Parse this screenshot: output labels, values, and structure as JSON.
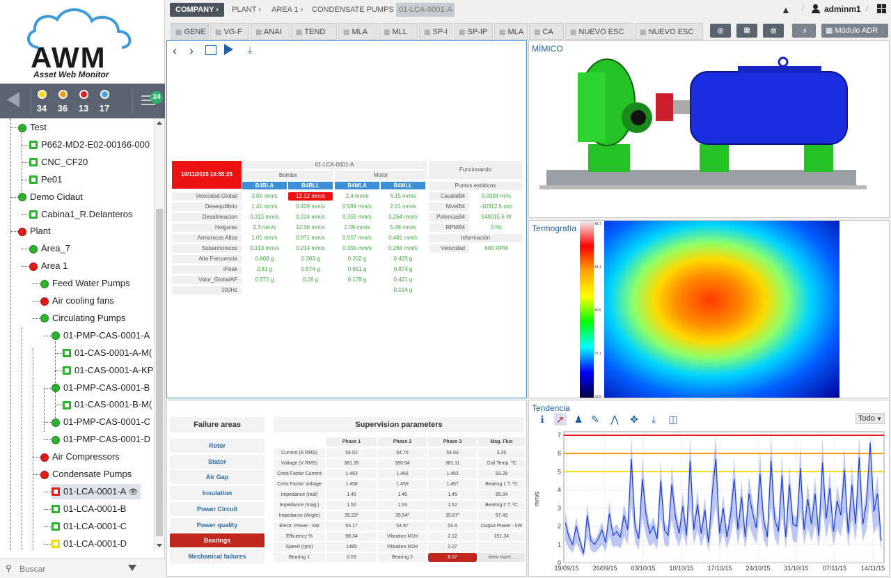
{
  "app": {
    "name": "AWM",
    "subtitle": "Asset Web Monitor"
  },
  "status": {
    "counts": [
      {
        "color": "#f5d90a",
        "value": "34"
      },
      {
        "color": "#f39c12",
        "value": "36"
      },
      {
        "color": "#e31b1b",
        "value": "13"
      },
      {
        "color": "#4ea3dc",
        "value": "17"
      }
    ],
    "list_badge": "24"
  },
  "tree": [
    {
      "label": "Test",
      "icon": "circle",
      "color": "#2db32d"
    },
    {
      "label": "P662-MD2-E02-00166-000",
      "icon": "square",
      "color": "#2db32d"
    },
    {
      "label": "CNC_CF20",
      "icon": "square",
      "color": "#2db32d"
    },
    {
      "label": "Pe01",
      "icon": "square",
      "color": "#2db32d"
    },
    {
      "label": "Demo Cidaut",
      "icon": "circle",
      "color": "#2db32d"
    },
    {
      "label": "Cabina1_R.Delanteros",
      "icon": "square",
      "color": "#2db32d"
    },
    {
      "label": "Plant",
      "icon": "circle",
      "color": "#e31b1b"
    },
    {
      "label": "Área_7",
      "icon": "circle",
      "color": "#2db32d"
    },
    {
      "label": "Area 1",
      "icon": "circle",
      "color": "#e31b1b"
    },
    {
      "label": "Feed Water Pumps",
      "icon": "circle",
      "color": "#2db32d"
    },
    {
      "label": "Air cooling fans",
      "icon": "circle",
      "color": "#e31b1b"
    },
    {
      "label": "Circulating Pumps",
      "icon": "circle",
      "color": "#2db32d"
    },
    {
      "label": "01-PMP-CAS-0001-A",
      "icon": "circle",
      "color": "#2db32d"
    },
    {
      "label": "01-CAS-0001-A-M(",
      "icon": "square",
      "color": "#2db32d"
    },
    {
      "label": "01-CAS-0001-A-KP",
      "icon": "square",
      "color": "#2db32d"
    },
    {
      "label": "01-PMP-CAS-0001-B",
      "icon": "circle",
      "color": "#2db32d"
    },
    {
      "label": "01-CAS-0001-B-M(",
      "icon": "square",
      "color": "#2db32d"
    },
    {
      "label": "01-PMP-CAS-0001-C",
      "icon": "circle",
      "color": "#2db32d"
    },
    {
      "label": "01-PMP-CAS-0001-D",
      "icon": "circle",
      "color": "#2db32d"
    },
    {
      "label": "Air Compressors",
      "icon": "circle",
      "color": "#e31b1b"
    },
    {
      "label": "Condensate Pumps",
      "icon": "circle",
      "color": "#e31b1b"
    },
    {
      "label": "01-LCA-0001-A",
      "icon": "square",
      "color": "#e31b1b"
    },
    {
      "label": "01-LCA-0001-B",
      "icon": "square",
      "color": "#2db32d"
    },
    {
      "label": "01-LCA-0001-C",
      "icon": "square",
      "color": "#2db32d"
    },
    {
      "label": "01-LCA-0001-D",
      "icon": "square",
      "color": "#f5d90a"
    }
  ],
  "search": {
    "placeholder": "Buscar"
  },
  "breadcrumb": [
    "COMPANY",
    "PLANT",
    "AREA 1",
    "CONDENSATE PUMPS",
    "01-LCA-0001-A"
  ],
  "user": "adminm1",
  "tabs": [
    "GENE",
    "VG-F",
    "ANAI",
    "TEND",
    "MLA",
    "MLL",
    "SP-I",
    "SP-IP",
    "MLA",
    "CA",
    "NUEVO ESC",
    "NUEVO ESC"
  ],
  "module_label": "Módulo ADR",
  "general": {
    "timestamp": "19/11/2015 16:55:25",
    "asset": "01-LCA-0001-A",
    "groups": [
      "Bomba",
      "Motor"
    ],
    "sensors": [
      "B4BLA",
      "B4BLL",
      "B4MLA",
      "B4MLL"
    ],
    "rows": [
      {
        "label": "Velocidad Global",
        "v": [
          "3.05 mm/s",
          "12.12 mm/s",
          "2.4 mm/s",
          "6.15 mm/s"
        ]
      },
      {
        "label": "Desequilibrio",
        "v": [
          "1.41 mm/s",
          "0.429 mm/s",
          "0.584 mm/s",
          "2.01 mm/s"
        ]
      },
      {
        "label": "Desalineacion",
        "v": [
          "0.313 mm/s",
          "0.214 mm/s",
          "0.355 mm/s",
          "0.264 mm/s"
        ]
      },
      {
        "label": "Holguras",
        "v": [
          "2.3 mm/s",
          "12.06 mm/s",
          "2.09 mm/s",
          "5.48 mm/s"
        ]
      },
      {
        "label": "Armonicos Altos",
        "v": [
          "1.01 mm/s",
          "0.971 mm/s",
          "0.557 mm/s",
          "0.481 mm/s"
        ]
      },
      {
        "label": "Subarmonicos",
        "v": [
          "0.313 mm/s",
          "0.214 mm/s",
          "0.355 mm/s",
          "0.264 mm/s"
        ]
      },
      {
        "label": "Alta Frecuencia",
        "v": [
          "0.608 g",
          "0.303 g",
          "0.202 g",
          "0.425 g"
        ]
      },
      {
        "label": "iPeak",
        "v": [
          "2.81 g",
          "0.574 g",
          "0.651 g",
          "0.874 g"
        ]
      },
      {
        "label": "Valor_GlobalAF",
        "v": [
          "0.572 g",
          "0.28 g",
          "0.178 g",
          "0.421 g"
        ]
      },
      {
        "label": "100Hz",
        "v": [
          "",
          "",
          "",
          "0.014 g"
        ]
      }
    ],
    "state": "Funcionando",
    "static_title": "Puntos estáticos",
    "static": [
      {
        "label": "CaudalB4",
        "value": "0.0004 m³/s"
      },
      {
        "label": "NivelB4",
        "value": "-10312.5 mm"
      },
      {
        "label": "PotenciaB4",
        "value": "548015.6 W"
      },
      {
        "label": "RPMB4",
        "value": "0 Hz"
      }
    ],
    "info_title": "Información",
    "info": [
      {
        "label": "Velocidad",
        "value": "600 RPM"
      }
    ]
  },
  "mimico_title": "MÍMICO",
  "thermo": {
    "title": "Termografía",
    "scale": [
      "48.7",
      "44.1",
      "40.6",
      "37.1",
      "33.6"
    ]
  },
  "failure": {
    "title": "Failure areas",
    "items": [
      "Rotor",
      "Stator",
      "Air Gap",
      "Insulation",
      "Power Circuit",
      "Power quality",
      "Bearings",
      "Mechanical failures"
    ],
    "active": "Bearings"
  },
  "supervision": {
    "title": "Supervision parameters",
    "headers": [
      "",
      "Phase 1",
      "Phase 2",
      "Phase 3",
      "Mag. Flux"
    ],
    "rows": [
      [
        "Current (A RMS)",
        "54.02",
        "54.76",
        "54.63",
        "3.20"
      ],
      [
        "Voltage (V RMS)",
        "381.35",
        "380.94",
        "381.11",
        "Coil Temp. ºC"
      ],
      [
        "Crest Factor Current",
        "1.463",
        "1.463",
        "1.463",
        "93.28"
      ],
      [
        "Crest Factor Voltage",
        "1.458",
        "1.459",
        "1.457",
        "Bearing 1 T. ºC"
      ],
      [
        "Impedance (real)",
        "1.45",
        "1.46",
        "1.45",
        "95.34"
      ],
      [
        "Impedance (mag.)",
        "1.52",
        "1.53",
        "1.52",
        "Bearing 2 T. ºC"
      ],
      [
        "Impedance (Angle)",
        "35.23º",
        "35.54º",
        "35.87º",
        "97.49"
      ],
      [
        "Electr. Power - kW",
        "53.17",
        "54.97",
        "53.9",
        "Output Power - kW"
      ],
      [
        "Efficiency %",
        "98.34",
        "Vibration M1H",
        "2.12",
        "151.34"
      ],
      [
        "Speed (rpm)",
        "1485",
        "Vibration M2H",
        "2.27",
        ""
      ],
      [
        "Bearing 1",
        "0.03",
        "Bearing 2",
        "8.07",
        "View more..."
      ]
    ]
  },
  "trend": {
    "title": "Tendencia",
    "dropdown": "Todo"
  },
  "chart_data": {
    "type": "line",
    "ylabel": "mm/s",
    "ylim": [
      0,
      7
    ],
    "yticks": [
      0,
      1,
      2,
      3,
      4,
      5,
      6,
      7
    ],
    "x": [
      "19/09/15",
      "26/09/15",
      "03/10/15",
      "10/10/15",
      "17/10/15",
      "24/10/15",
      "31/10/15",
      "07/11/15",
      "14/11/15"
    ],
    "thresholds": [
      {
        "value": 7,
        "color": "#e31b1b"
      },
      {
        "value": 6,
        "color": "#f39c12"
      },
      {
        "value": 5,
        "color": "#f5d90a"
      }
    ],
    "series": [
      {
        "values": [
          2.2,
          1.4,
          1.0,
          2.0,
          1.2,
          0.5,
          2.6,
          1.2,
          1.0,
          1.3,
          1.8,
          1.1,
          2.7,
          1.5,
          1.7,
          1.4,
          2.6,
          1.8,
          5.7,
          2.0,
          1.3,
          4.6,
          2.6,
          1.6,
          2.0,
          1.3,
          4.5,
          1.8,
          1.5,
          4.3,
          2.5,
          1.6,
          3.1,
          1.5,
          5.6,
          1.8,
          3.2,
          1.6,
          2.9,
          1.1,
          3.8,
          5.7,
          1.6,
          3.0,
          1.4,
          2.6,
          4.6,
          1.8,
          3.6,
          1.4,
          3.8,
          2.7,
          1.9,
          4.9,
          2.3,
          1.4,
          5.6,
          2.4,
          1.7,
          4.8,
          1.4,
          4.3,
          2.1,
          2.0,
          5.2,
          1.8,
          3.5,
          2.1,
          3.8,
          1.5,
          5.5,
          2.4,
          4.1,
          1.7,
          3.4,
          2.6,
          5.1,
          1.6,
          4.3,
          2.1,
          5.8,
          2.1,
          3.3,
          6.6,
          2.8,
          3.8,
          1.2
        ]
      }
    ]
  }
}
